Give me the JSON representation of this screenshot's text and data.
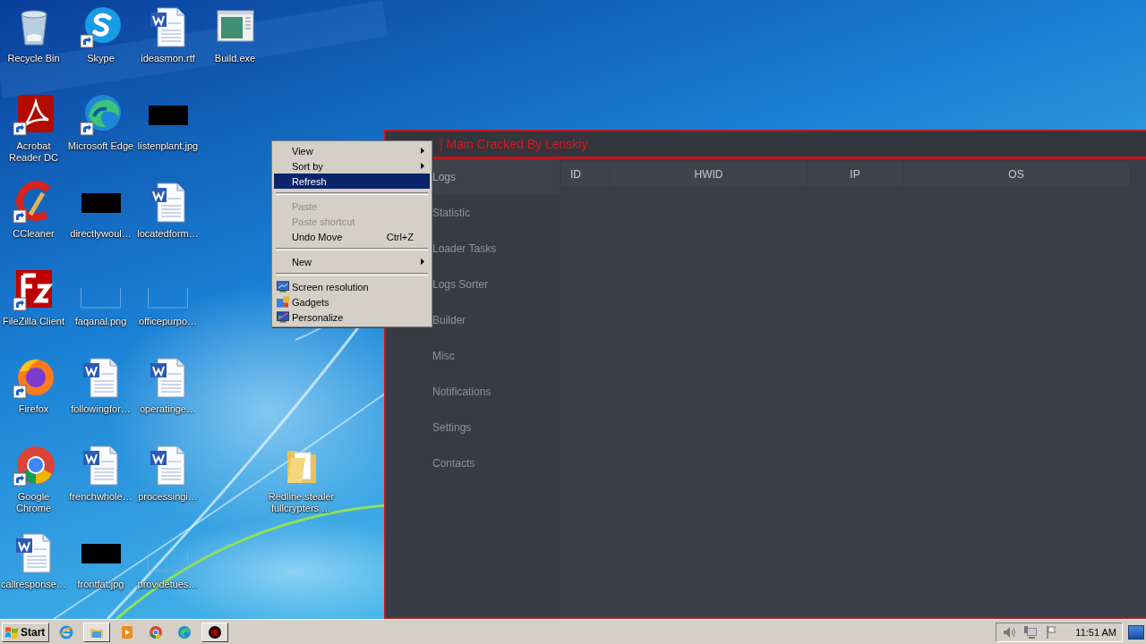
{
  "desktop": {
    "columns": [
      {
        "icons": [
          {
            "label": "Recycle Bin",
            "shortcut": false
          },
          {
            "label": "Acrobat\nReader DC",
            "shortcut": true
          },
          {
            "label": "CCleaner",
            "shortcut": true
          },
          {
            "label": "FileZilla Client",
            "shortcut": true
          },
          {
            "label": "Firefox",
            "shortcut": true
          },
          {
            "label": "Google\nChrome",
            "shortcut": true
          },
          {
            "label": "callresponse…",
            "shortcut": false
          }
        ]
      },
      {
        "icons": [
          {
            "label": "Skype",
            "shortcut": true
          },
          {
            "label": "Microsoft Edge",
            "shortcut": true
          },
          {
            "label": "directlywoul…",
            "shortcut": false
          },
          {
            "label": "faqanal.png",
            "shortcut": false
          },
          {
            "label": "followingfor…",
            "shortcut": false
          },
          {
            "label": "frenchwhole…",
            "shortcut": false
          },
          {
            "label": "frontfat.jpg",
            "shortcut": false
          }
        ]
      },
      {
        "icons": [
          {
            "label": "ideasmon.rtf",
            "shortcut": false
          },
          {
            "label": "listenplant.jpg",
            "shortcut": false
          },
          {
            "label": "locatedform…",
            "shortcut": false
          },
          {
            "label": "officepurpo…",
            "shortcut": false
          },
          {
            "label": "operatinge…",
            "shortcut": false
          },
          {
            "label": "processingi…",
            "shortcut": false
          },
          {
            "label": "providetues…",
            "shortcut": false
          }
        ]
      },
      {
        "icons": [
          {
            "label": "Build.exe",
            "shortcut": false
          }
        ]
      }
    ],
    "extra_icons": [
      {
        "label": "Redline stealer\nfullcrypters …",
        "shortcut": false
      }
    ]
  },
  "app_window": {
    "title": "| Main Cracked By Lenskiy",
    "sidebar": [
      {
        "label": "Logs",
        "selected": true
      },
      {
        "label": "Statistic",
        "selected": false
      },
      {
        "label": "Loader Tasks",
        "selected": false
      },
      {
        "label": "Logs Sorter",
        "selected": false
      },
      {
        "label": "Builder",
        "selected": false
      },
      {
        "label": "Misc",
        "selected": false
      },
      {
        "label": "Notifications",
        "selected": false
      },
      {
        "label": "Settings",
        "selected": false
      },
      {
        "label": "Contacts",
        "selected": false
      }
    ],
    "table": {
      "columns": [
        "ID",
        "HWID",
        "IP",
        "OS"
      ]
    }
  },
  "context_menu": {
    "items": [
      {
        "kind": "item",
        "label": "View",
        "submenu": true,
        "disabled": false,
        "selected": false,
        "icon": false
      },
      {
        "kind": "item",
        "label": "Sort by",
        "submenu": true,
        "disabled": false,
        "selected": false,
        "icon": false
      },
      {
        "kind": "item",
        "label": "Refresh",
        "submenu": false,
        "disabled": false,
        "selected": true,
        "icon": false
      },
      {
        "kind": "separator"
      },
      {
        "kind": "item",
        "label": "Paste",
        "submenu": false,
        "disabled": true,
        "selected": false,
        "icon": false
      },
      {
        "kind": "item",
        "label": "Paste shortcut",
        "submenu": false,
        "disabled": true,
        "selected": false,
        "icon": false
      },
      {
        "kind": "item",
        "label": "Undo Move",
        "shortcut": "Ctrl+Z",
        "submenu": false,
        "disabled": false,
        "selected": false,
        "icon": false
      },
      {
        "kind": "separator"
      },
      {
        "kind": "item",
        "label": "New",
        "submenu": true,
        "disabled": false,
        "selected": false,
        "icon": false
      },
      {
        "kind": "separator"
      },
      {
        "kind": "item",
        "label": "Screen resolution",
        "submenu": false,
        "disabled": false,
        "selected": false,
        "icon": true
      },
      {
        "kind": "item",
        "label": "Gadgets",
        "submenu": false,
        "disabled": false,
        "selected": false,
        "icon": true
      },
      {
        "kind": "item",
        "label": "Personalize",
        "submenu": false,
        "disabled": false,
        "selected": false,
        "icon": true
      }
    ]
  },
  "taskbar": {
    "start_label": "Start",
    "apps": [
      {
        "kind": "pinned"
      },
      {
        "kind": "window"
      },
      {
        "kind": "pinned"
      },
      {
        "kind": "pinned"
      },
      {
        "kind": "pinned"
      },
      {
        "kind": "window"
      }
    ],
    "clock": "11:51 AM"
  }
}
